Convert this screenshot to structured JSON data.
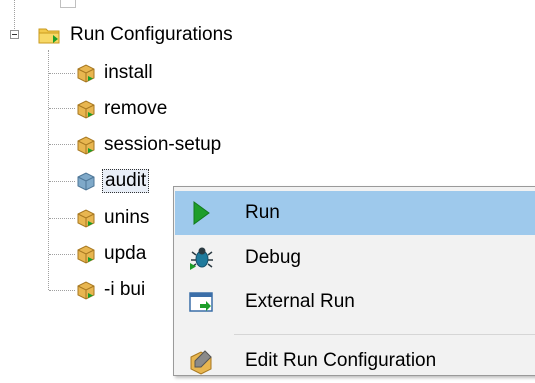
{
  "tree": {
    "folder": {
      "label": "Run Configurations",
      "icon": "folder-run-icon"
    },
    "items": [
      {
        "label": "install",
        "icon": "package-icon"
      },
      {
        "label": "remove",
        "icon": "package-icon"
      },
      {
        "label": "session-setup",
        "icon": "package-icon"
      },
      {
        "label": "audit",
        "icon": "package-selected-icon",
        "selected": true
      },
      {
        "label": "unins",
        "icon": "package-icon"
      },
      {
        "label": "upda",
        "icon": "package-icon"
      },
      {
        "label": "-i bui",
        "icon": "package-icon"
      }
    ]
  },
  "context_menu": {
    "items": [
      {
        "label": "Run",
        "icon": "run-icon",
        "highlighted": true
      },
      {
        "label": "Debug",
        "icon": "debug-icon"
      },
      {
        "label": "External Run",
        "icon": "external-run-icon"
      },
      {
        "label": "Edit Run Configuration",
        "icon": "edit-config-icon"
      }
    ]
  },
  "colors": {
    "highlight": "#9ec9ec",
    "menu_background": "#f2f2f2",
    "run_green": "#1e9e2a",
    "folder_yellow": "#f2c94c"
  }
}
